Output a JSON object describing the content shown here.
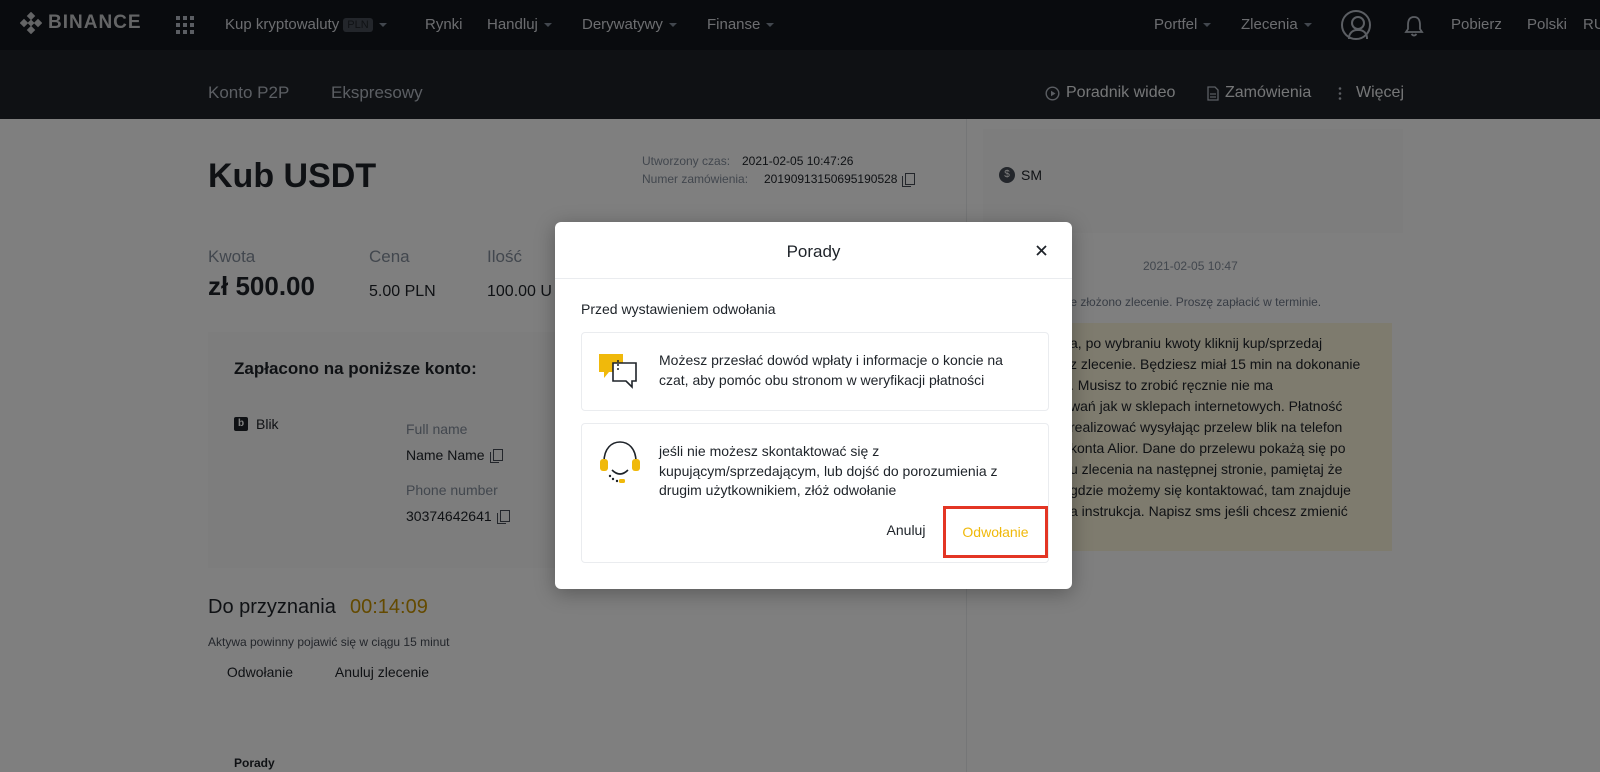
{
  "colors": {
    "nav_bg": "#12161c",
    "accent": "#f0b90b",
    "timer": "#c99400",
    "highlight_border": "#e33524"
  },
  "topnav": {
    "logo_text": "BINANCE",
    "buy_crypto": "Kup kryptowaluty",
    "buy_crypto_badge": "PLN",
    "markets": "Rynki",
    "trade": "Handluj",
    "derivatives": "Derywatywy",
    "finance": "Finanse",
    "wallet": "Portfel",
    "orders": "Zlecenia",
    "download": "Pobierz",
    "language": "Polski",
    "currency": "RU"
  },
  "subnav": {
    "tab_p2p": "Konto P2P",
    "tab_express": "Ekspresowy",
    "video_guide": "Poradnik wideo",
    "orders": "Zamówienia",
    "more": "Więcej"
  },
  "order": {
    "title": "Kub USDT",
    "created_label": "Utworzony czas:",
    "created_value": "2021-02-05 10:47:26",
    "order_no_label": "Numer zamówienia:",
    "order_no_value": "20190913150695190528",
    "amount_label": "Kwota",
    "amount_value": "zł 500.00",
    "price_label": "Cena",
    "price_value": "5.00 PLN",
    "quantity_label": "Ilość",
    "quantity_value": "100.00 U"
  },
  "payment": {
    "title": "Zapłacono na poniższe konto:",
    "method": "Blik",
    "full_name_label": "Full name",
    "full_name_value": "Name Name",
    "phone_label": "Phone number",
    "phone_value": "30374642641"
  },
  "release": {
    "label": "Do przyznania",
    "timer": "00:14:09",
    "note": "Aktywa powinny pojawić się w ciągu 15 minut",
    "appeal_button": "Odwołanie",
    "cancel_order_button": "Anuluj zlecenie",
    "tips_label": "Porady"
  },
  "chat": {
    "counterparty": "SM",
    "date": "2021-02-05 10:47",
    "system_message": "nie złożono zlecenie. Proszę zapłacić w terminie.",
    "bubble_lines": [
      "a, po wybraniu kwoty kliknij kup/sprzedaj",
      "z zlecenie. Będziesz miał 15 min na dokonanie",
      ". Musisz to zrobić ręcznie nie ma",
      "wań jak w sklepach internetowych. Płatność",
      "realizować wysyłając przelew blik na telefon",
      "konta Alior. Dane do przelewu pokażą się po",
      "u zlecenia na następnej stronie, pamiętaj że",
      "gdzie możemy się kontaktować, tam znajduje",
      "a instrukcja. Napisz sms jeśli chcesz zmienić"
    ]
  },
  "modal": {
    "title": "Porady",
    "subtitle": "Przed wystawieniem odwołania",
    "tip1_lines": [
      "Możesz przesłać dowód wpłaty i informacje o koncie na",
      "czat, aby pomóc obu stronom w weryfikacji płatności"
    ],
    "tip2_lines": [
      "jeśli nie możesz skontaktować się z",
      "kupującym/sprzedającym, lub dojść do porozumienia z",
      "drugim użytkownikiem, złóż odwołanie"
    ],
    "cancel_button": "Anuluj",
    "appeal_button": "Odwołanie"
  }
}
